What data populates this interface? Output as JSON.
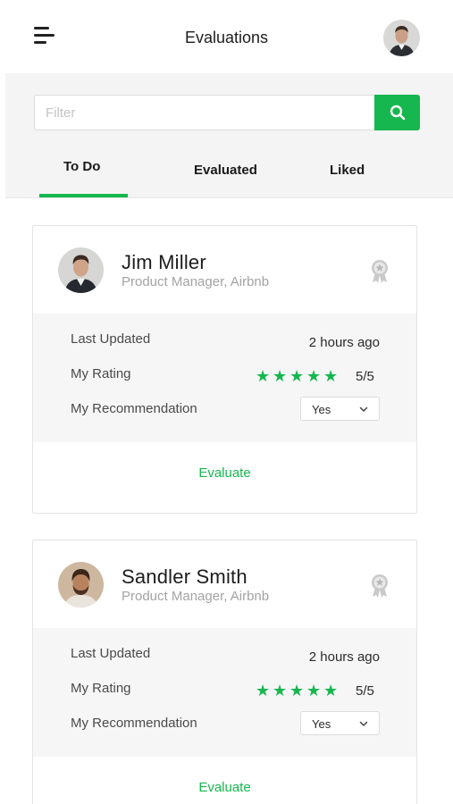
{
  "header": {
    "title": "Evaluations",
    "menu_icon": "hamburger-menu-icon",
    "avatar_icon": "user-avatar"
  },
  "filter": {
    "placeholder": "Filter",
    "value": "",
    "search_icon": "search-icon"
  },
  "tabs": [
    {
      "label": "To Do",
      "active": true
    },
    {
      "label": "Evaluated",
      "active": false
    },
    {
      "label": "Liked",
      "active": false
    }
  ],
  "cards": [
    {
      "name": "Jim Miller",
      "role": "Product Manager, Airbnb",
      "badge_icon": "award-ribbon-icon",
      "last_updated_label": "Last Updated",
      "last_updated_value": "2 hours ago",
      "rating_label": "My Rating",
      "rating_stars": 5,
      "rating_value": "5/5",
      "recommendation_label": "My Recommendation",
      "recommendation_value": "Yes",
      "action_label": "Evaluate"
    },
    {
      "name": "Sandler Smith",
      "role": "Product Manager, Airbnb",
      "badge_icon": "award-ribbon-icon",
      "last_updated_label": "Last Updated",
      "last_updated_value": "2 hours ago",
      "rating_label": "My Rating",
      "rating_stars": 5,
      "rating_value": "5/5",
      "recommendation_label": "My Recommendation",
      "recommendation_value": "Yes",
      "action_label": "Evaluate"
    }
  ],
  "colors": {
    "accent": "#16b74e",
    "panel_bg": "#f4f4f4",
    "muted_text": "#a3a3a3"
  }
}
